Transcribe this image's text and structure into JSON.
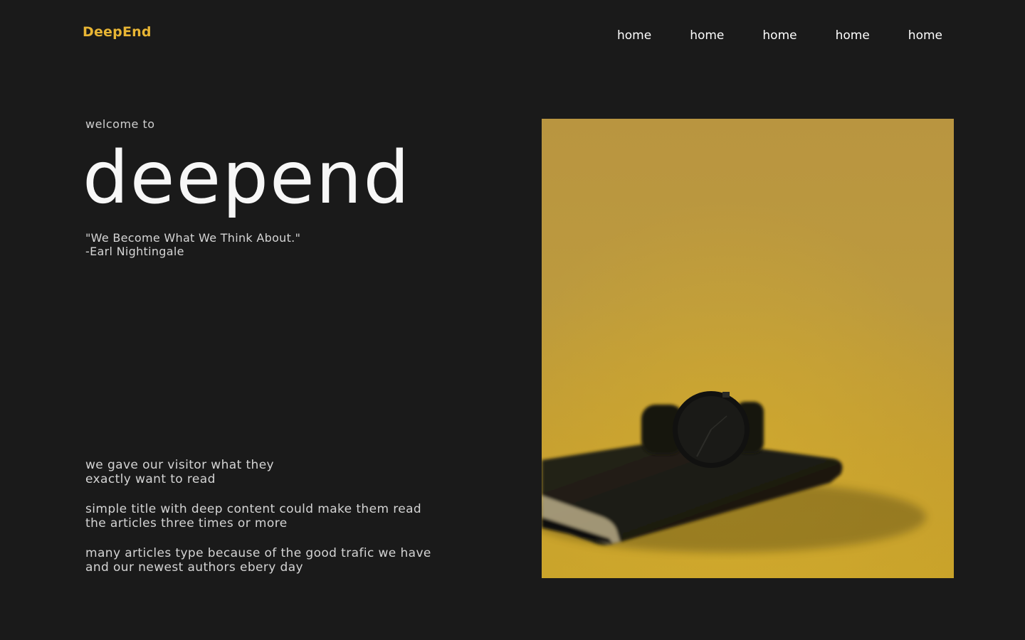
{
  "header": {
    "brand": "DeepEnd",
    "nav": [
      {
        "label": "home"
      },
      {
        "label": "home"
      },
      {
        "label": "home"
      },
      {
        "label": "home"
      },
      {
        "label": "home"
      }
    ]
  },
  "hero": {
    "welcome": "welcome to",
    "title": "deepend",
    "quote_text": "\"We Become What We Think About.\"",
    "quote_author": "-Earl Nightingale"
  },
  "description": [
    {
      "text": "we gave our visitor what they\nexactly want to read"
    },
    {
      "text": "simple title with deep content could make them read\nthe articles three times or more"
    },
    {
      "text": "many articles type because of the good trafic we have\nand our newest authors ebery day"
    }
  ],
  "colors": {
    "background": "#1a1a1a",
    "accent": "#e8b534",
    "photo_backdrop": "#bc9a3e"
  }
}
